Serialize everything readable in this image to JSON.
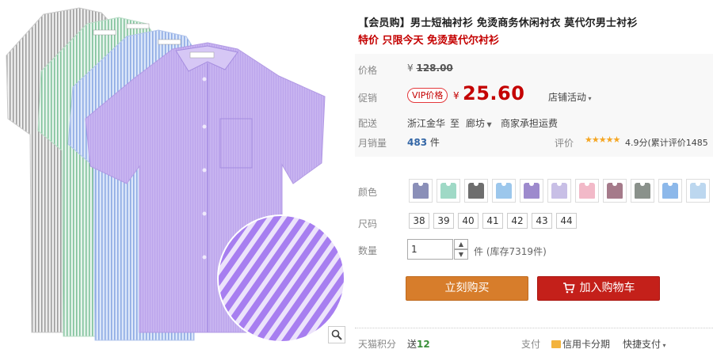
{
  "product": {
    "title": "【会员购】男士短袖衬衫 免烫商务休闲衬衣 莫代尔男士衬衫",
    "subtitle": "特价 只限今天 免烫莫代尔衬衫"
  },
  "price": {
    "label": "价格",
    "currency": "¥",
    "original": "128.00",
    "promo_label": "促销",
    "vip_badge": "VIP价格",
    "sale": "25.60",
    "promo_dropdown": "店铺活动"
  },
  "shipping": {
    "label": "配送",
    "from": "浙江金华",
    "to_word": "至",
    "to": "廊坊",
    "fee": "商家承担运费"
  },
  "sales": {
    "label": "月销量",
    "count": "483",
    "unit": "件",
    "rating_label": "评价",
    "rating_text": "4.9分(累计评价1485"
  },
  "colors": {
    "label": "颜色",
    "swatches": [
      {
        "name": "紫色条纹",
        "color": "#8a8fb8"
      },
      {
        "name": "浅绿",
        "color": "#9fd9c6"
      },
      {
        "name": "深灰",
        "color": "#6e6e6e"
      },
      {
        "name": "天蓝",
        "color": "#9cc7ec"
      },
      {
        "name": "紫色",
        "color": "#9d8acd"
      },
      {
        "name": "淡紫",
        "color": "#c8bfe6"
      },
      {
        "name": "粉色",
        "color": "#f2b9c8"
      },
      {
        "name": "紫红",
        "color": "#a57a8a"
      },
      {
        "name": "灰色",
        "color": "#8a918b"
      },
      {
        "name": "蓝色",
        "color": "#8cb8ea"
      },
      {
        "name": "浅蓝",
        "color": "#bcd7ef"
      }
    ]
  },
  "sizes": {
    "label": "尺码",
    "options": [
      "38",
      "39",
      "40",
      "41",
      "42",
      "43",
      "44"
    ]
  },
  "quantity": {
    "label": "数量",
    "value": "1",
    "unit": "件",
    "stock": "(库存7319件)"
  },
  "actions": {
    "buy_now": "立刻购买",
    "add_to_cart": "加入购物车"
  },
  "footer": {
    "points_label": "天猫积分",
    "points_value_prefix": "送",
    "points_value": "12",
    "pay_label": "支付",
    "card_installment": "信用卡分期",
    "express_pay": "快捷支付"
  },
  "theme": {
    "price_red": "#c40000",
    "buy_orange": "#d77d2b",
    "cart_red": "#c4201a"
  }
}
